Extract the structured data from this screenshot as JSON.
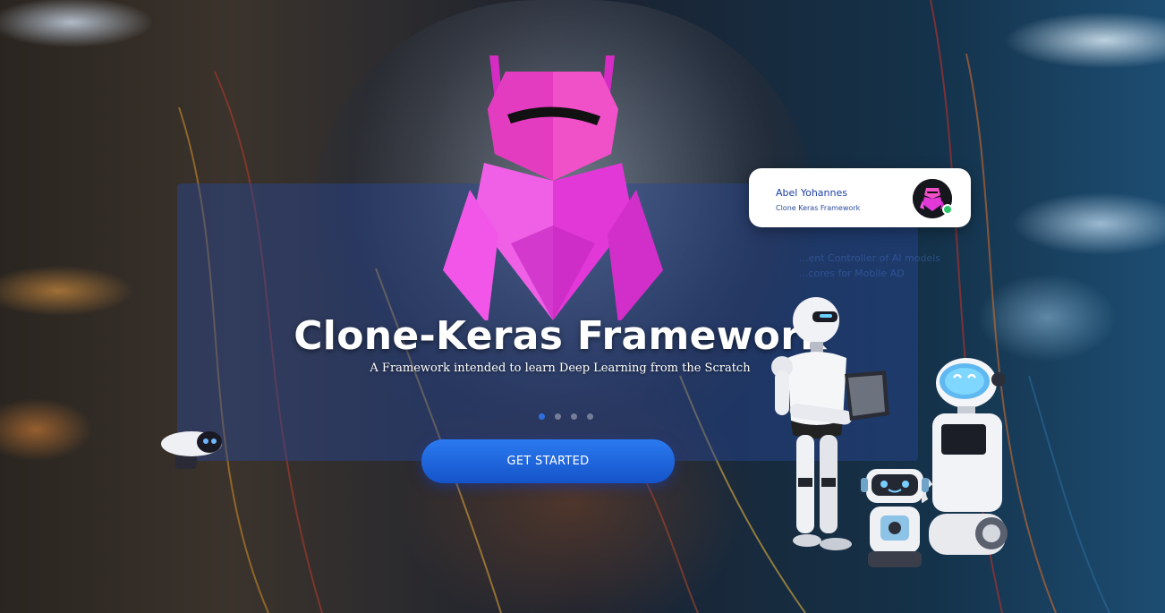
{
  "hero": {
    "title": "Clone-Keras Framework",
    "subtitle": "A Framework intended to learn Deep Learning from the Scratch",
    "cta_label": "GET STARTED",
    "carousel": {
      "slide_count": 4,
      "active_index": 0
    }
  },
  "profile_card": {
    "name": "Abel Yohannes",
    "project": "Clone Keras Framework",
    "status": "online"
  },
  "faint_text": {
    "line1": "...ent Controller of AI models",
    "line2": "...cores for Mobile AD",
    "footer": ""
  },
  "colors": {
    "accent": "#1553c9",
    "logo_pink": "#e83fd6",
    "online": "#2bc86a",
    "panel": "#284696"
  },
  "icons": [
    "pink-robot-logo-icon",
    "android-robot-icon",
    "companion-robot-icon",
    "small-robot-icon",
    "camera-robot-icon"
  ]
}
